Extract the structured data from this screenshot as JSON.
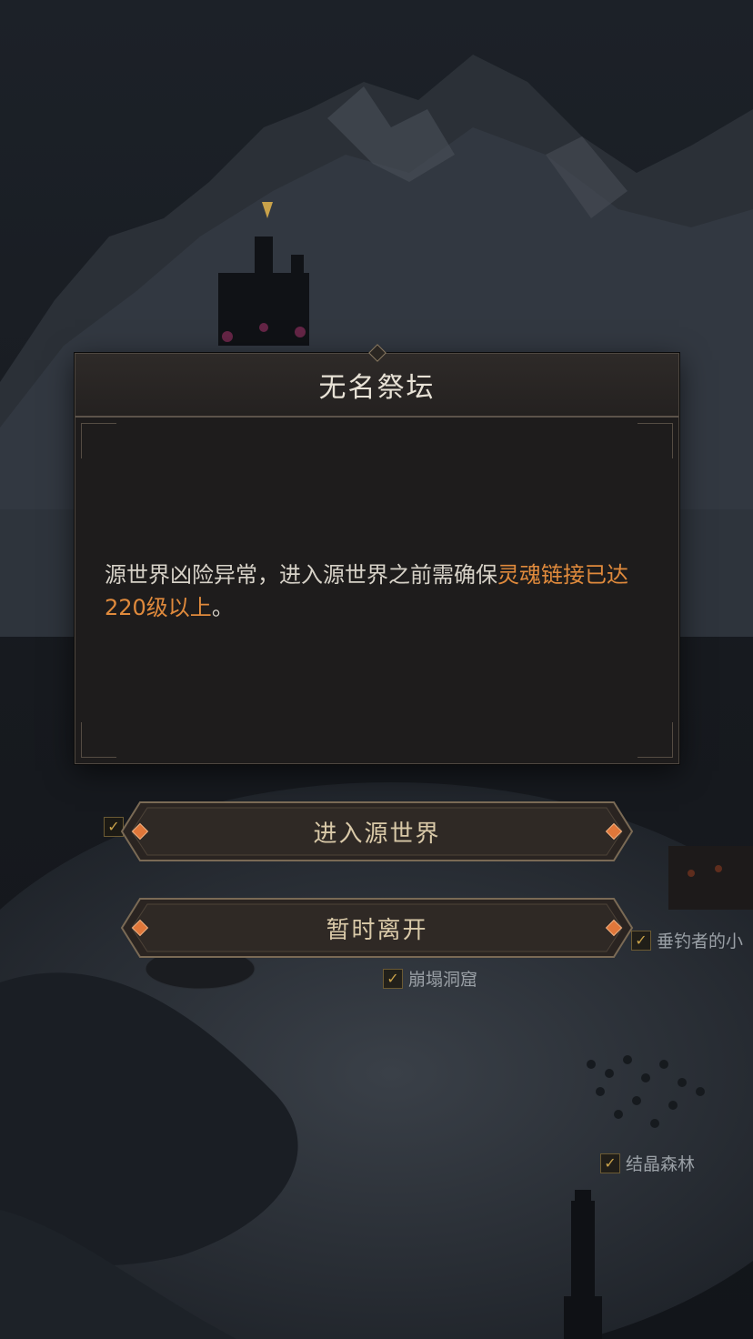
{
  "dialog": {
    "title": "无名祭坛",
    "message_prefix": "源世界凶险异常，进入源世界之前需确保",
    "message_highlight": "灵魂链接已达220级以上",
    "message_suffix": "。"
  },
  "buttons": {
    "enter_label": "进入源世界",
    "leave_label": "暂时离开"
  },
  "map_labels": {
    "fisher_hut": "垂钓者的小",
    "collapsed_cave": "崩塌洞窟",
    "crystal_forest": "结晶森林"
  },
  "colors": {
    "highlight": "#e08a3c",
    "check_gold": "#c9a24a"
  }
}
